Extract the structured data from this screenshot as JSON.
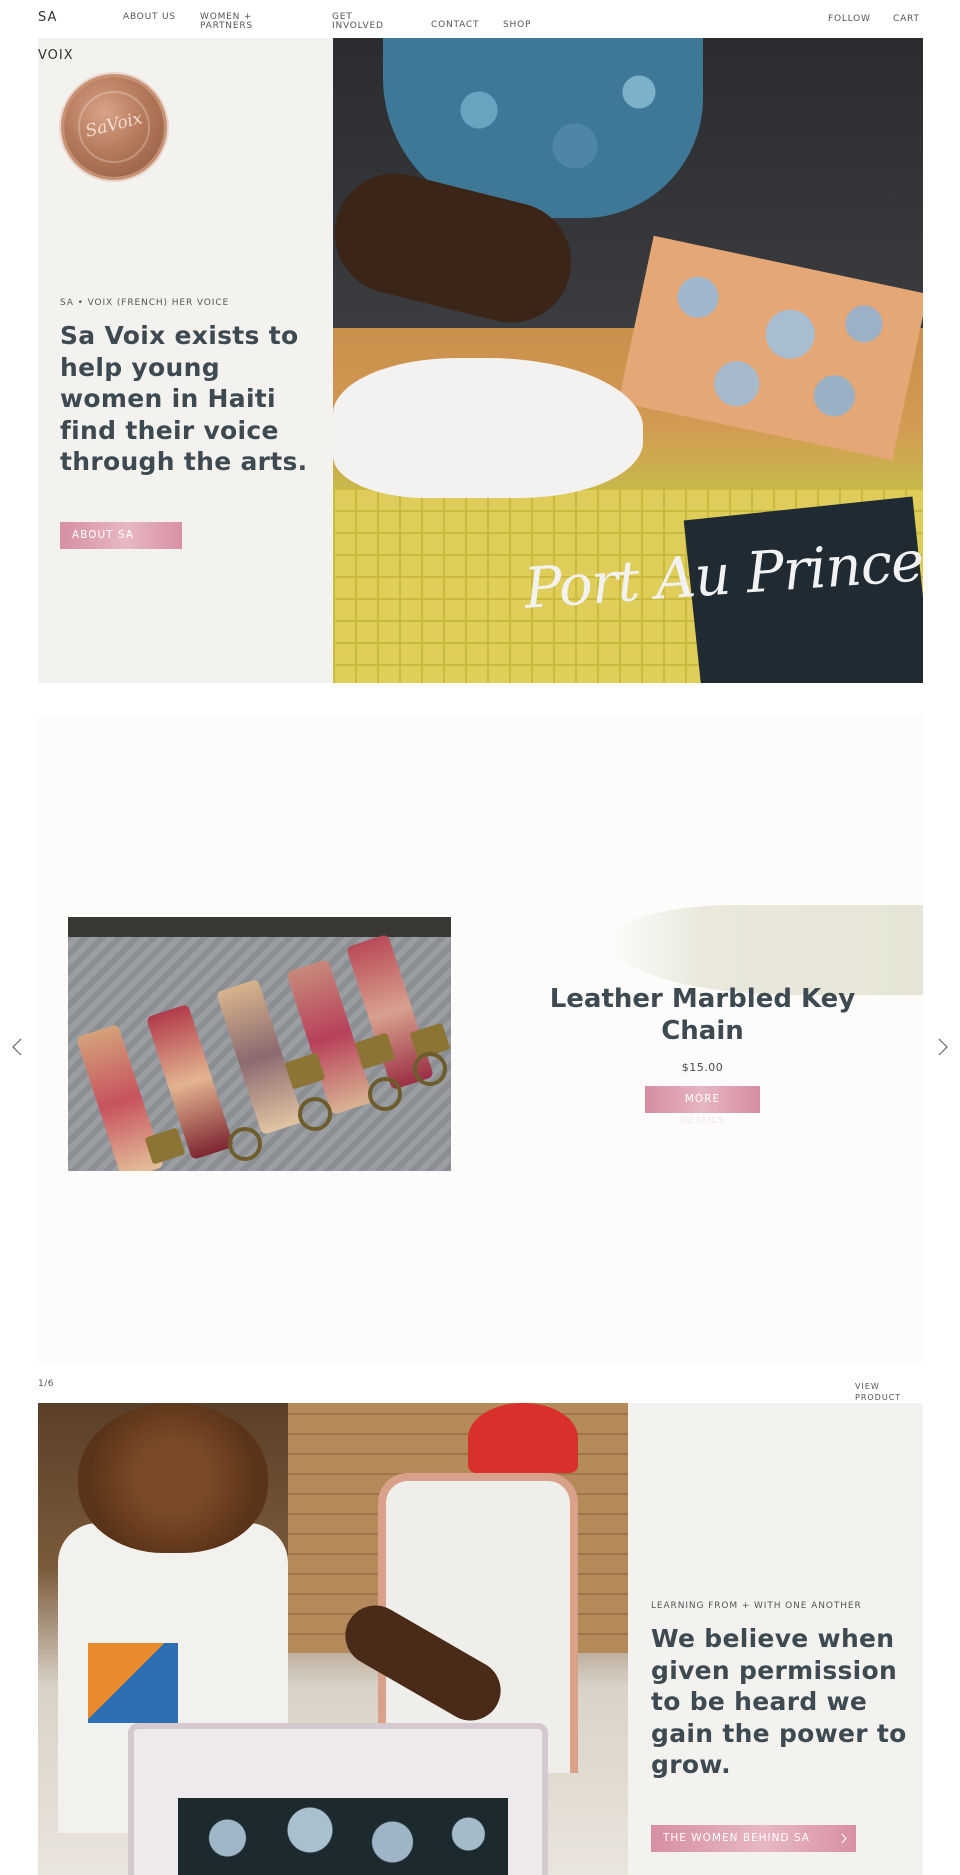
{
  "nav": {
    "logo_line1": "SA",
    "logo_line2": "VOIX",
    "links": [
      "ABOUT US",
      "WOMEN + PARTNERS",
      "GET INVOLVED",
      "CONTACT",
      "SHOP"
    ],
    "follow": "FOLLOW",
    "cart": "CART"
  },
  "hero": {
    "seal_text": "SaVoix",
    "kicker": "SA • VOIX (FRENCH) HER VOICE",
    "headline": "Sa Voix exists to help young women in Haiti find their voice through the arts.",
    "button": "ABOUT SA",
    "photo_script": "Port Au Prince"
  },
  "slider": {
    "product_title": "Leather Marbled Key Chain",
    "price": "$15.00",
    "button": "MORE",
    "button_ghost": "DETAILS",
    "prev_icon": "chevron-left-icon",
    "next_icon": "chevron-right-icon",
    "counter": "1/6",
    "view_product": "VIEW PRODUCT"
  },
  "women": {
    "kicker": "LEARNING FROM + WITH ONE ANOTHER",
    "headline": "We believe when given permission to be heard we gain the power to grow.",
    "button": "THE WOMEN BEHIND SA",
    "button_icon": "chevron-right-icon"
  },
  "colors": {
    "text": "#3e4a52",
    "accent_pink": "#d78fa3",
    "panel_bg": "#f4f2ef"
  }
}
